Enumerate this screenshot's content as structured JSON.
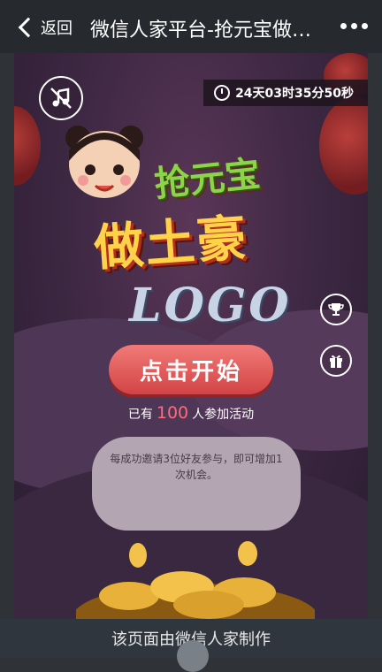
{
  "nav": {
    "back_label": "返回",
    "title": "微信人家平台-抢元宝做土豪"
  },
  "game": {
    "countdown": "24天03时35分50秒",
    "title_top": "抢元宝",
    "title_main": "做土豪",
    "logo": "LOGO",
    "start_label": "点击开始",
    "joined_prefix": "已有",
    "joined_count": "100",
    "joined_suffix": "人参加活动",
    "invite_rule": "每成功邀请3位好友参与，即可增加1次机会。"
  },
  "footer": {
    "text": "该页面由微信人家制作"
  },
  "icons": {
    "music": "music-off-icon",
    "rank": "trophy-icon",
    "prize": "gift-icon",
    "clock": "clock-icon"
  },
  "colors": {
    "accent": "#e0575a",
    "count": "#ff6b7a",
    "title_gold": "#ffd24a",
    "title_green": "#8fd34a"
  }
}
